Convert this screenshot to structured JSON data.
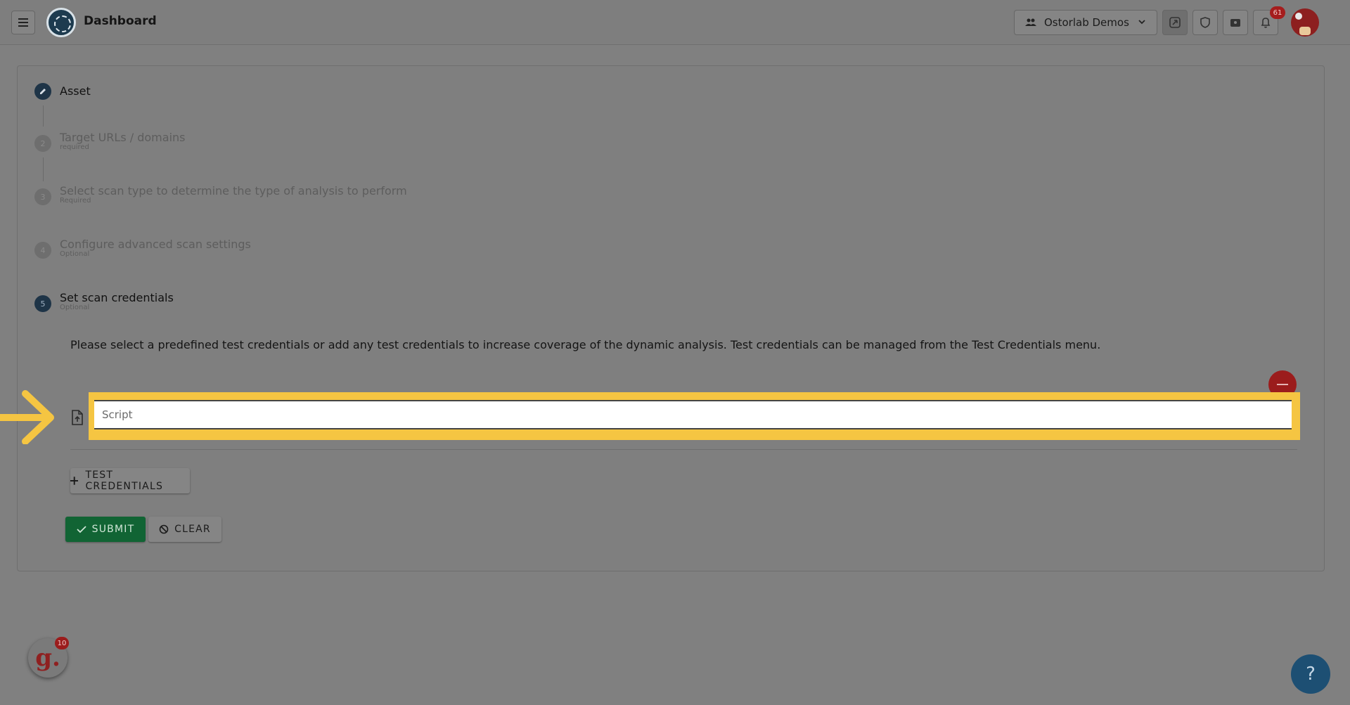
{
  "header": {
    "title": "Dashboard",
    "org_name": "Ostorlab Demos",
    "notification_count": "61",
    "icons": [
      "menu-icon",
      "logo-icon",
      "users-icon",
      "chevron-down-icon",
      "scan-icon",
      "shield-icon",
      "ticket-icon",
      "bell-icon",
      "avatar"
    ]
  },
  "steps": [
    {
      "number": "",
      "title": "Asset",
      "subtitle": ""
    },
    {
      "number": "2",
      "title": "Target URLs / domains",
      "subtitle": "required"
    },
    {
      "number": "3",
      "title": "Select scan type to determine the type of analysis to perform",
      "subtitle": "Required"
    },
    {
      "number": "4",
      "title": "Configure advanced scan settings",
      "subtitle": "Optional"
    },
    {
      "number": "5",
      "title": "Set scan credentials",
      "subtitle": "Optional"
    }
  ],
  "credentials": {
    "instructions": "Please select a predefined test credentials or add any test credentials to increase coverage of the dynamic analysis. Test credentials can be managed from the Test Credentials menu.",
    "script_placeholder": "Script",
    "script_value": "",
    "add_button": "TEST CREDENTIALS"
  },
  "actions": {
    "submit": "SUBMIT",
    "clear": "CLEAR"
  },
  "widgets": {
    "guide_badge": "10",
    "guide_letter": "g.",
    "help": "?"
  },
  "colors": {
    "highlight": "#f5c542",
    "submit": "#116434",
    "remove": "#9b1c1c",
    "help": "#1d4f73"
  }
}
